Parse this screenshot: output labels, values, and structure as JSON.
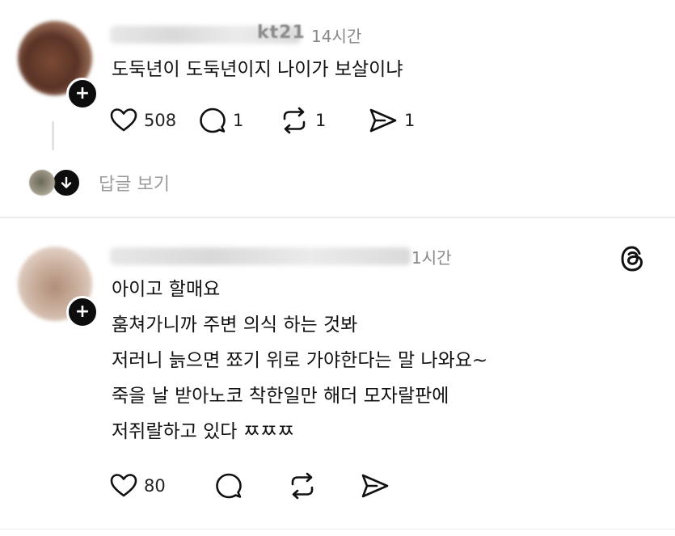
{
  "post1": {
    "username_tail": "kt21",
    "time": "14시간",
    "text": "도둑년이 도둑년이지 나이가 보살이냐",
    "likes": "508",
    "replies": "1",
    "reposts": "1",
    "shares": "1",
    "view_replies_label": "답글 보기"
  },
  "post2": {
    "time": "1시간",
    "lines": [
      "아이고 할매요",
      "훔쳐가니까 주변 의식 하는 것봐",
      "저러니 늙으면 쬬기 위로 가야한다는 말 나와요~",
      "죽을 날 받아노코 착한일만 해더 모자랄판에",
      "저쥐랄하고 있다 ㅉㅉㅉ"
    ],
    "likes": "80"
  },
  "icons": {
    "like": "heart-icon",
    "reply": "comment-icon",
    "repost": "repost-icon",
    "share": "send-icon",
    "follow": "plus-icon",
    "brand": "threads-logo-icon"
  },
  "colors": {
    "text": "#111111",
    "muted": "#888888",
    "badge": "#0d0d0d"
  }
}
